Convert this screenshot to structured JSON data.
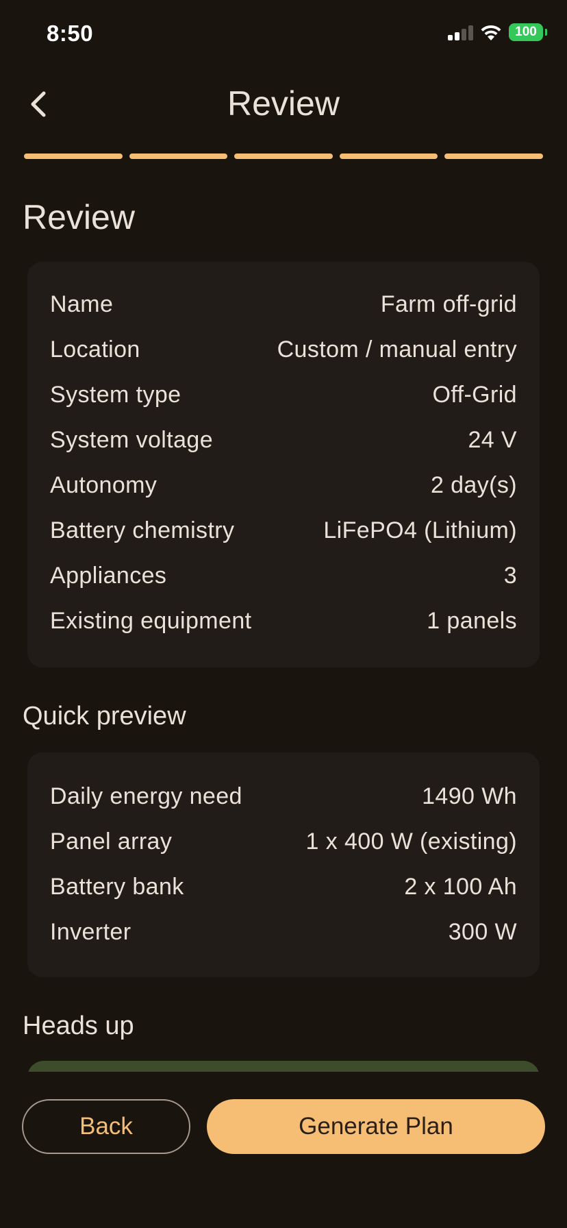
{
  "status_bar": {
    "time": "8:50",
    "battery": "100",
    "signal_icon": "cellular-signal-icon",
    "wifi_icon": "wifi-icon"
  },
  "header": {
    "title": "Review",
    "back_icon": "chevron-left-icon"
  },
  "progress": {
    "total_steps": 5,
    "completed_steps": 5,
    "color": "#f6bd74"
  },
  "page": {
    "heading": "Review"
  },
  "review": {
    "rows": [
      {
        "label": "Name",
        "value": "Farm off-grid"
      },
      {
        "label": "Location",
        "value": "Custom / manual entry"
      },
      {
        "label": "System type",
        "value": "Off-Grid"
      },
      {
        "label": "System voltage",
        "value": "24 V"
      },
      {
        "label": "Autonomy",
        "value": "2 day(s)"
      },
      {
        "label": "Battery chemistry",
        "value": "LiFePO4 (Lithium)"
      },
      {
        "label": "Appliances",
        "value": "3"
      },
      {
        "label": "Existing equipment",
        "value": "1 panels"
      }
    ]
  },
  "preview": {
    "heading": "Quick preview",
    "rows": [
      {
        "label": "Daily energy need",
        "value": "1490 Wh"
      },
      {
        "label": "Panel array",
        "value": "1 x 400 W (existing)"
      },
      {
        "label": "Battery bank",
        "value": "2 x 100 Ah"
      },
      {
        "label": "Inverter",
        "value": "300 W"
      }
    ]
  },
  "heads_up": {
    "heading": "Heads up"
  },
  "footer": {
    "back_label": "Back",
    "generate_label": "Generate Plan"
  },
  "colors": {
    "background": "#1a140f",
    "card": "#221c18",
    "accent": "#f6bd74",
    "heads_up_card": "#3d4d2b"
  }
}
